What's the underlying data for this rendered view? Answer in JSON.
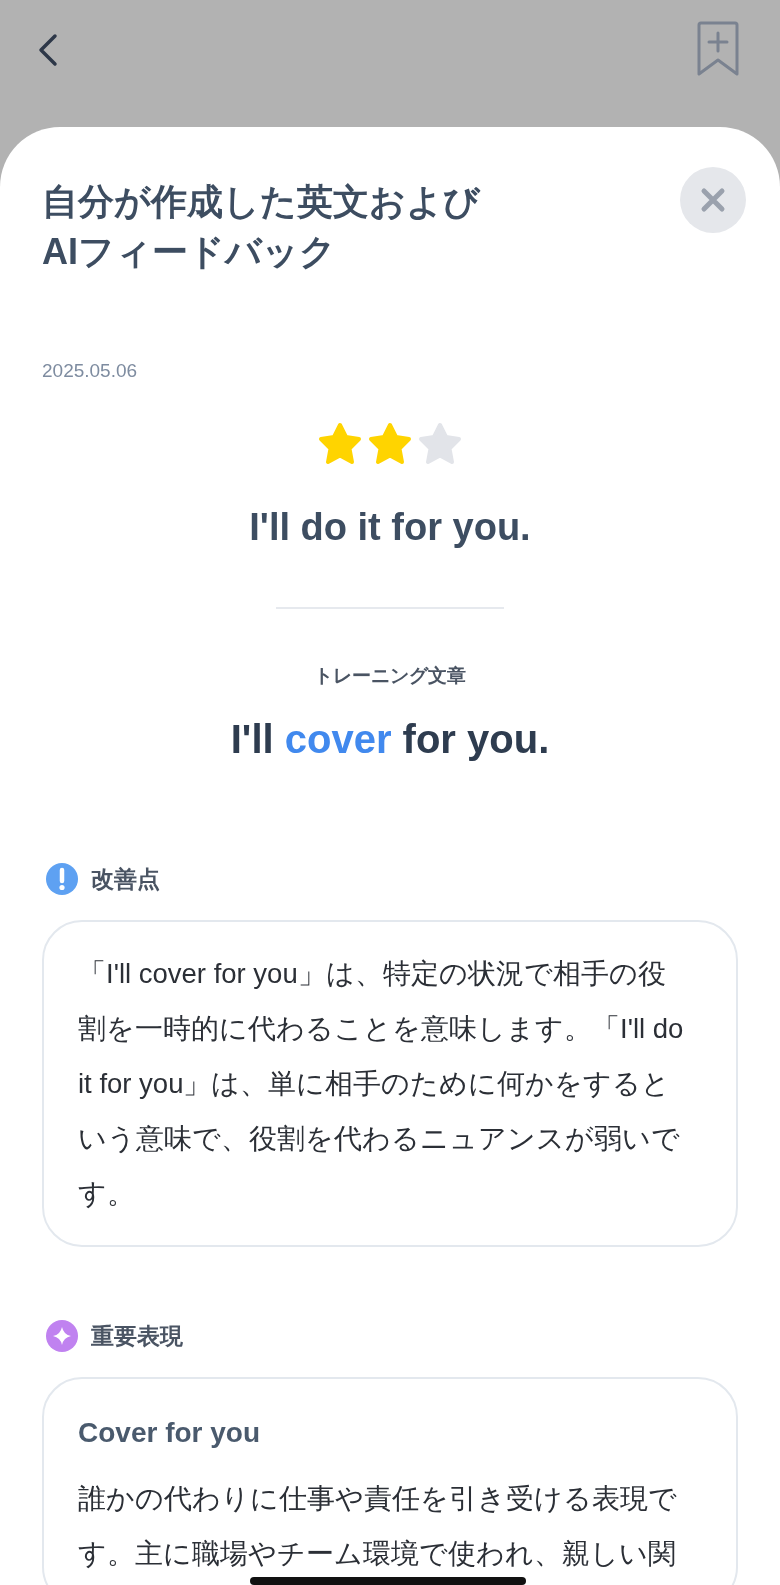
{
  "sheet": {
    "title": "自分が作成した英文および\nAIフィードバック",
    "date": "2025.05.06",
    "stars": 2,
    "user_sentence": "I'll do it for you.",
    "training_label": "トレーニング文章",
    "training_sentence": [
      {
        "text": "I'll ",
        "highlight": false
      },
      {
        "text": "cover",
        "highlight": true
      },
      {
        "text": " for you.",
        "highlight": false
      }
    ],
    "sections": [
      {
        "kind": "improvement",
        "heading": "改善点",
        "body": "「I'll cover for you」は、特定の状況で相手の役割を一時的に代わることを意味します。「I'll do it for you」は、単に相手のために何かをするという意味で、役割を代わるニュアンスが弱いです。"
      },
      {
        "kind": "expression",
        "heading": "重要表現",
        "card_title": "Cover for you",
        "body": "誰かの代わりに仕事や責任を引き受ける表現です。主に職場やチーム環境で使われ、親しい関"
      }
    ]
  }
}
